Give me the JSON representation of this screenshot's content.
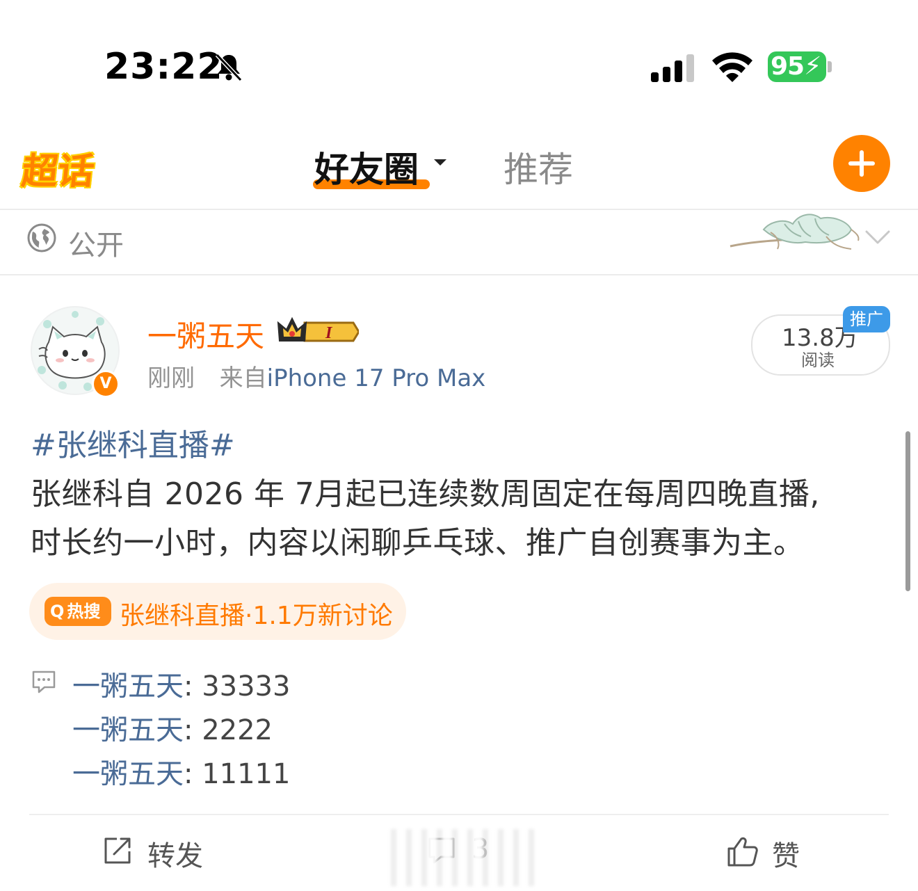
{
  "status_bar": {
    "time": "23:22",
    "battery": "95"
  },
  "nav": {
    "logo": "超话",
    "tab_active": "好友圈",
    "tab_inactive": "推荐",
    "accent_color": "#ff8200"
  },
  "visibility": {
    "label": "公开"
  },
  "post": {
    "author": "一粥五天",
    "time": "刚刚",
    "from_prefix": "来自",
    "source": "iPhone 17 Pro Max",
    "reads": {
      "count": "13.8万",
      "label": "阅读",
      "tag": "推广"
    },
    "hashtag": "#张继科直播#",
    "body_lines": [
      "张继科自 2026 年 7月起已连续数周固定在每周四晚直播,",
      "时长约一小时，内容以闲聊乒乓球、推广自创赛事为主。"
    ],
    "hot_search": {
      "badge": "热搜",
      "text": "张继科直播·1.1万新讨论"
    },
    "comments": [
      {
        "name": "一粥五天",
        "text": ": 33333"
      },
      {
        "name": "一粥五天",
        "text": ": 2222"
      },
      {
        "name": "一粥五天",
        "text": ": 11111"
      }
    ],
    "actions": {
      "repost": "转发",
      "comment_count": "3",
      "like": "赞"
    }
  }
}
